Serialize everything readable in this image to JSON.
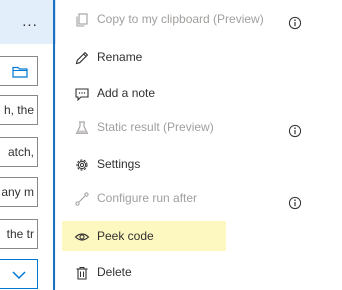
{
  "designer": {
    "more_label": "...",
    "fields": [
      {
        "text": ""
      },
      {
        "text": "h, the"
      },
      {
        "text": "atch,"
      },
      {
        "text": "any m"
      },
      {
        "text": "the tr"
      },
      {
        "text": ""
      }
    ]
  },
  "menu": {
    "items": [
      {
        "label": "Copy to my clipboard (Preview)",
        "icon": "copy-icon",
        "disabled": true,
        "info": true
      },
      {
        "label": "Rename",
        "icon": "pencil-icon",
        "disabled": false,
        "info": false
      },
      {
        "label": "Add a note",
        "icon": "comment-icon",
        "disabled": false,
        "info": false
      },
      {
        "label": "Static result (Preview)",
        "icon": "flask-icon",
        "disabled": true,
        "info": true
      },
      {
        "label": "Settings",
        "icon": "gear-icon",
        "disabled": false,
        "info": false
      },
      {
        "label": "Configure run after",
        "icon": "run-after-icon",
        "disabled": true,
        "info": true
      },
      {
        "label": "Peek code",
        "icon": "eye-icon",
        "disabled": false,
        "highlighted": true,
        "info": false
      },
      {
        "label": "Delete",
        "icon": "trash-icon",
        "disabled": false,
        "info": false
      }
    ]
  },
  "colors": {
    "accent": "#0078d4",
    "highlight": "#fdf7c0",
    "disabled_text": "#a19f9d",
    "header_bg": "#e3eefb"
  }
}
